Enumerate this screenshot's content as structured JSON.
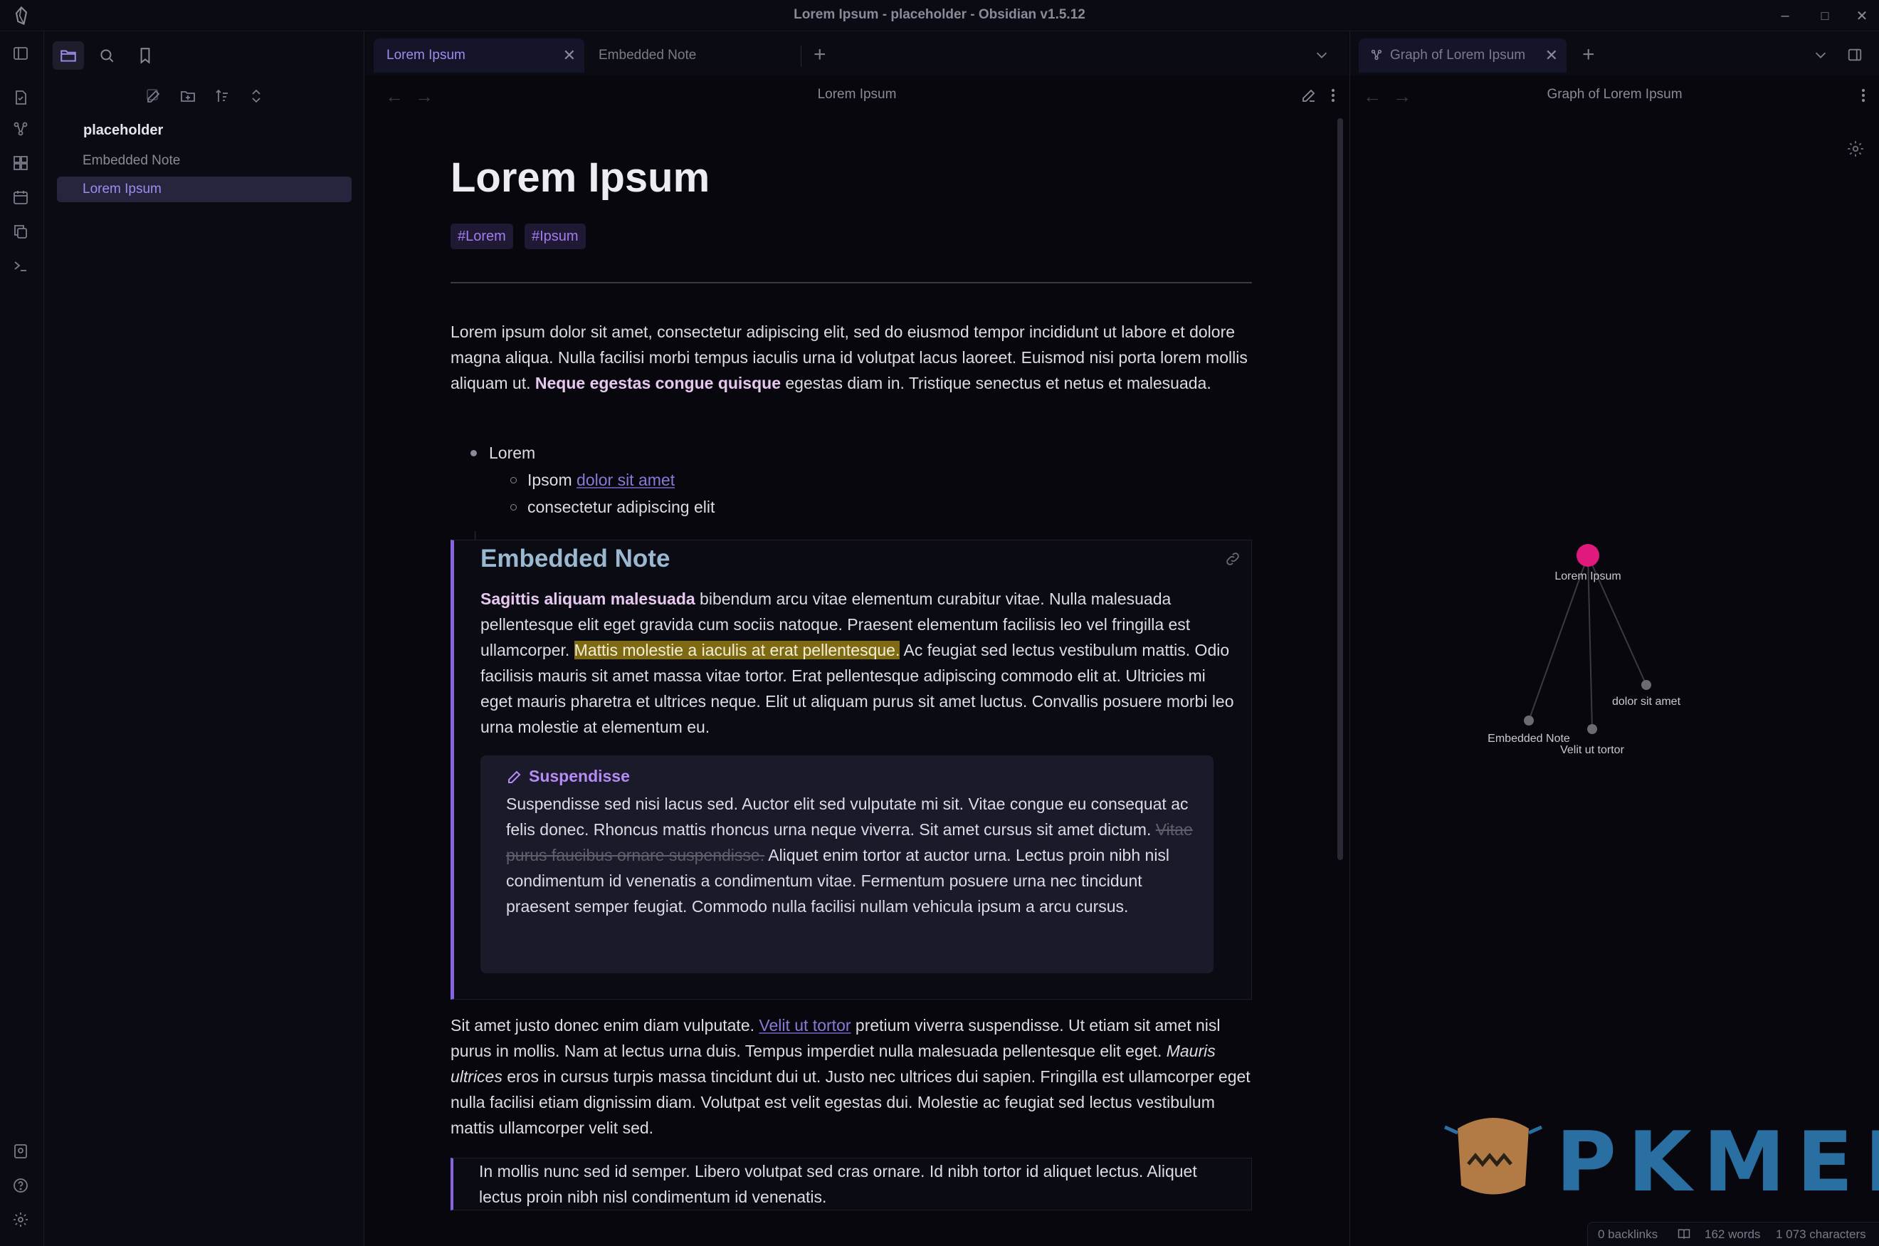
{
  "window": {
    "title": "Lorem Ipsum - placeholder - Obsidian v1.5.12"
  },
  "sidebar": {
    "vault_name": "placeholder",
    "files": [
      {
        "label": "Embedded Note",
        "active": false
      },
      {
        "label": "Lorem Ipsum",
        "active": true
      }
    ]
  },
  "tabs": {
    "left": [
      {
        "label": "Lorem Ipsum",
        "active": true
      },
      {
        "label": "Embedded Note",
        "active": false
      }
    ],
    "right": [
      {
        "label": "Graph of Lorem Ipsum",
        "active": true
      }
    ]
  },
  "editor": {
    "view_title": "Lorem Ipsum",
    "note_title": "Lorem Ipsum",
    "tags": [
      "#Lorem",
      "#Ipsum"
    ],
    "para1": {
      "text_a": "Lorem ipsum dolor sit amet, consectetur adipiscing elit, sed do eiusmod tempor incididunt ut labore et dolore magna aliqua. Nulla facilisi morbi tempus iaculis urna id volutpat lacus laoreet. Euismod nisi porta lorem mollis aliquam ut. ",
      "bold": "Neque egestas congue quisque",
      "text_b": " egestas diam in. Tristique senectus et netus et malesuada."
    },
    "list": {
      "item1": "Lorem",
      "item2_prefix": "Ipsom ",
      "item2_link": "dolor sit amet",
      "item3": "consectetur adipiscing elit"
    },
    "embed": {
      "title": "Embedded Note",
      "bold": "Sagittis aliquam malesuada",
      "text_a": " bibendum arcu vitae elementum curabitur vitae. Nulla malesuada pellentesque elit eget gravida cum sociis natoque. Praesent elementum facilisis leo vel fringilla est ullamcorper. ",
      "highlight": "Mattis molestie a iaculis at erat pellentesque.",
      "text_b": " Ac feugiat sed lectus vestibulum mattis. Odio facilisis mauris sit amet massa vitae tortor. Erat pellentesque adipiscing commodo elit at. Ultricies mi eget mauris pharetra et ultrices neque. Elit ut aliquam purus sit amet luctus. Convallis posuere morbi leo urna molestie at elementum eu.",
      "callout": {
        "title": "Suspendisse",
        "text_a": "Suspendisse sed nisi lacus sed. Auctor elit sed vulputate mi sit. Vitae congue eu consequat ac felis donec. Rhoncus mattis rhoncus urna neque viverra. Sit amet cursus sit amet dictum. ",
        "strike": "Vitae purus faucibus ornare suspendisse.",
        "text_b": " Aliquet enim tortor at auctor urna. Lectus proin nibh nisl condimentum id venenatis a condimentum vitae. Fermentum posuere urna nec tincidunt praesent semper feugiat. Commodo nulla facilisi nullam vehicula ipsum a arcu cursus."
      }
    },
    "para2": {
      "text_a": "Sit amet justo donec enim diam vulputate. ",
      "link": "Velit ut tortor",
      "text_b": " pretium viverra suspendisse. Ut etiam sit amet nisl purus in mollis. Nam at lectus urna duis. Tempus imperdiet nulla malesuada pellentesque elit eget. ",
      "italic": "Mauris ultrices",
      "text_c": " eros in cursus turpis massa tincidunt dui ut. Justo nec ultrices dui sapien. Fringilla est ullamcorper eget nulla facilisi etiam dignissim diam. Volutpat est velit egestas dui. Molestie ac feugiat sed lectus vestibulum mattis ullamcorper velit sed."
    },
    "quote": "In mollis nunc sed id semper. Libero volutpat sed cras ornare. Id nibh tortor id aliquet lectus. Aliquet lectus proin nibh nisl condimentum id venenatis."
  },
  "graph": {
    "view_title": "Graph of Lorem Ipsum",
    "nodes": [
      {
        "id": "lorem",
        "label": "Lorem Ipsum",
        "current": true
      },
      {
        "id": "embedded",
        "label": "Embedded Note",
        "current": false
      },
      {
        "id": "velit",
        "label": "Velit ut tortor",
        "current": false
      },
      {
        "id": "dolor",
        "label": "dolor sit amet",
        "current": false
      }
    ],
    "edges": [
      [
        "lorem",
        "embedded"
      ],
      [
        "lorem",
        "velit"
      ],
      [
        "lorem",
        "dolor"
      ]
    ],
    "colors": {
      "current": "#e0197d",
      "node": "#6b6b74",
      "edge": "#3a3a44",
      "label": "#c8c8d0"
    }
  },
  "watermark": {
    "text": "PKMER"
  },
  "statusbar": {
    "backlinks": "0 backlinks",
    "words": "162 words",
    "characters": "1 073 characters"
  },
  "colors": {
    "accent": "#9f8cf0",
    "background": "#07070d",
    "tag_bg": "#1f1933",
    "highlight": "#7d6a12"
  }
}
